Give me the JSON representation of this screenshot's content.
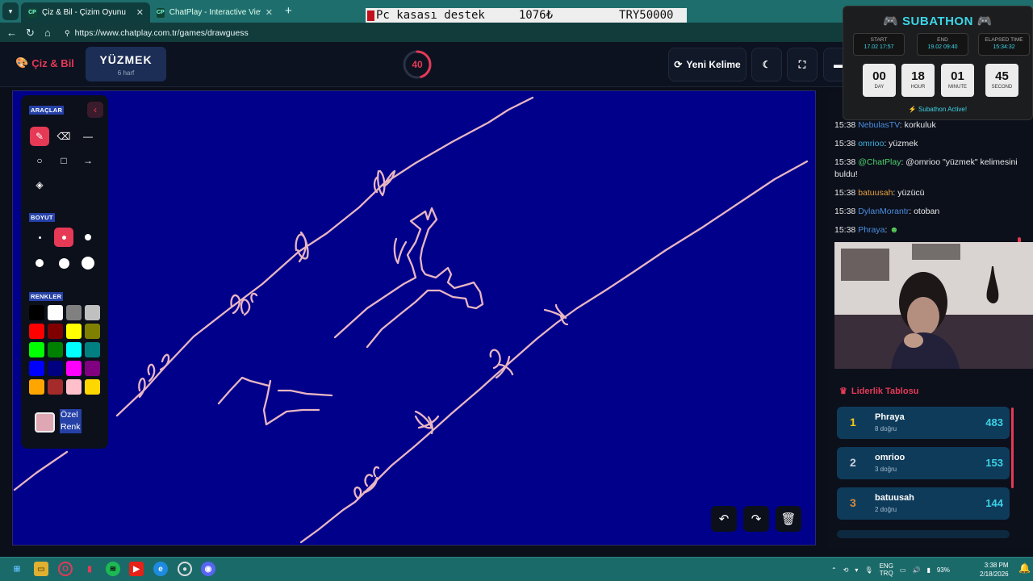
{
  "browser": {
    "tabs": [
      {
        "label": "Çiz & Bil - Çizim Oyunu",
        "favicon": "CP",
        "active": true
      },
      {
        "label": "ChatPlay - Interactive Viewer Gam",
        "favicon": "CP",
        "active": false
      }
    ],
    "url": "https://www.chatplay.com.tr/games/drawguess"
  },
  "overlay_banner": {
    "text1": "Pc kasası destek",
    "text2": "1076₺",
    "text3": "TRY50000"
  },
  "header": {
    "logo": "Çiz & Bil",
    "word": "YÜZMEK",
    "word_length": "6 harf",
    "timer": "40",
    "timer_progress": 0.45,
    "new_word_label": "Yeni Kelime"
  },
  "tools": {
    "section_tools": "ARAÇLAR",
    "section_size": "BOYUT",
    "section_colors": "RENKLER",
    "custom_color_line1": "Özel",
    "custom_color_line2": "Renk",
    "tool_items": [
      "pencil-icon",
      "eraser-icon",
      "line-icon",
      "circle-icon",
      "square-icon",
      "arrow-icon",
      "fill-icon"
    ],
    "active_tool": "pencil-icon",
    "active_size_index": 1,
    "colors": [
      "#000000",
      "#ffffff",
      "#808080",
      "#c0c0c0",
      "#ff0000",
      "#800000",
      "#ffff00",
      "#808000",
      "#00ff00",
      "#008000",
      "#00ffff",
      "#008080",
      "#0000ff",
      "#000080",
      "#ff00ff",
      "#800080",
      "#ffa500",
      "#a52a2a",
      "#ffc0cb",
      "#ffd700"
    ],
    "custom_color": "#dea7b3"
  },
  "chat": [
    {
      "time": "15:38",
      "user": "NebulasTV",
      "user_color": "#4a8fe0",
      "text": ": korkuluk"
    },
    {
      "time": "15:38",
      "user": "omrioo",
      "user_color": "#3ab0e0",
      "text": ": yüzmek"
    },
    {
      "time": "15:38",
      "user": "@ChatPlay",
      "user_color": "#4ed06a",
      "text": ": @omrioo \"yüzmek\" kelimesini buldu!"
    },
    {
      "time": "15:38",
      "user": "batuusah",
      "user_color": "#e6a040",
      "text": ": yüzücü"
    },
    {
      "time": "15:38",
      "user": "DylanMorantr",
      "user_color": "#4a8fe0",
      "text": ": otoban"
    },
    {
      "time": "15:38",
      "user": "Phraya",
      "user_color": "#4a8fe0",
      "text": ":"
    }
  ],
  "leaderboard": {
    "title": "Liderlik Tablosu",
    "rows": [
      {
        "rank": "1",
        "name": "Phraya",
        "correct": "8 doğru",
        "points": "483",
        "rank_color": "#f5c518"
      },
      {
        "rank": "2",
        "name": "omrioo",
        "correct": "3 doğru",
        "points": "153",
        "rank_color": "#c9d2dc"
      },
      {
        "rank": "3",
        "name": "batuusah",
        "correct": "2 doğru",
        "points": "144",
        "rank_color": "#d68a3c"
      }
    ]
  },
  "subathon": {
    "title": "SUBATHON",
    "start_label": "START",
    "start_value": "17.02 17:57",
    "end_label": "END",
    "end_value": "19.02 09:40",
    "elapsed_label": "ELAPSED TIME",
    "elapsed_value": "15:34:32",
    "day": "00",
    "hour": "18",
    "minute": "01",
    "second": "45",
    "day_label": "DAY",
    "hour_label": "HOUR",
    "minute_label": "MINUTE",
    "second_label": "SECOND",
    "status": "⚡ Subathon Active!"
  },
  "taskbar": {
    "lang1": "ENG",
    "lang2": "TRQ",
    "battery": "93%",
    "time": "3:38 PM",
    "date": "2/18/2026"
  },
  "colors": {
    "accent": "#e53956",
    "canvas": "#00008b",
    "stroke": "#e9b6c2"
  }
}
